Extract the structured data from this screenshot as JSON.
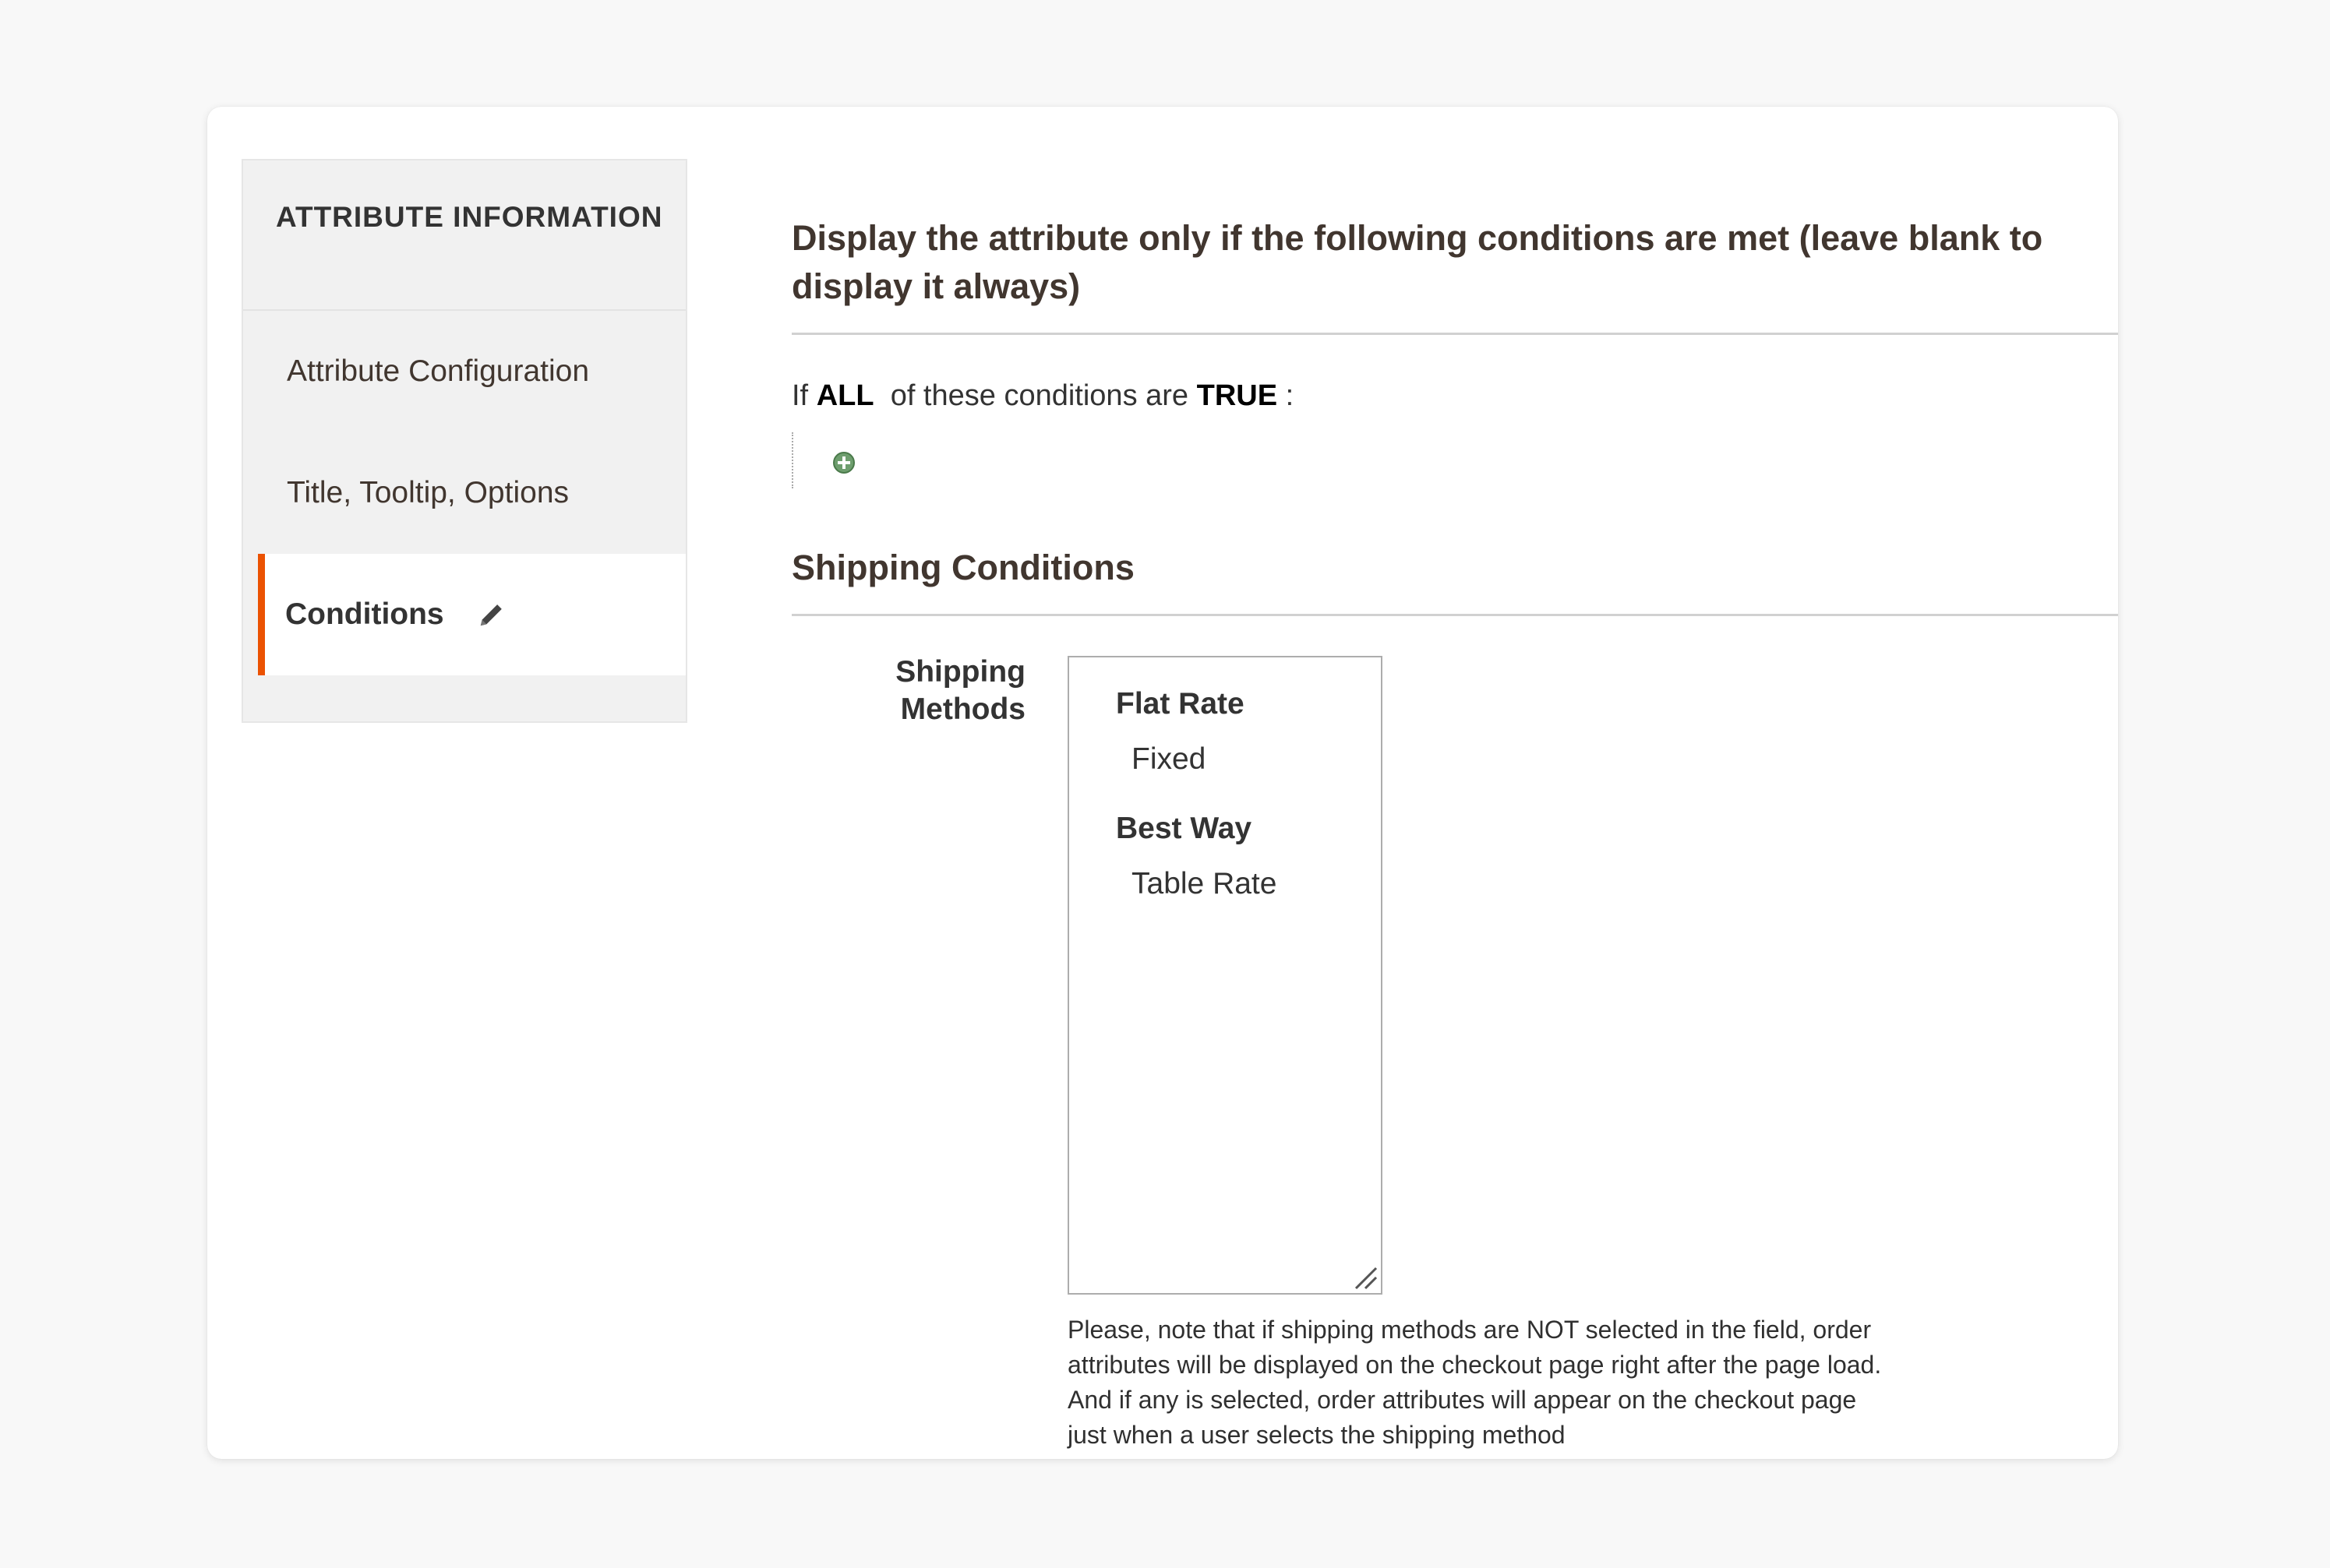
{
  "sidebar": {
    "title": "ATTRIBUTE INFORMATION",
    "items": [
      {
        "label": "Attribute Configuration"
      },
      {
        "label": "Title, Tooltip, Options"
      },
      {
        "label": "Conditions",
        "active": true
      }
    ]
  },
  "main": {
    "section_title": "Display the attribute only if the following conditions are met (leave blank to display it always)",
    "condition": {
      "prefix": "If",
      "aggregator": "ALL",
      "middle": "of these conditions are",
      "value": "TRUE",
      "suffix": ":"
    },
    "shipping_title": "Shipping Conditions",
    "shipping_field": {
      "label": "Shipping Methods",
      "groups": [
        {
          "label": "Flat Rate",
          "options": [
            "Fixed"
          ]
        },
        {
          "label": "Best Way",
          "options": [
            "Table Rate"
          ]
        }
      ],
      "note": "Please, note that if shipping methods are NOT selected in the field, order attributes will be displayed on the checkout page right after the page load. And if any is selected, order attributes will appear on the checkout page just when a user selects the shipping method"
    }
  },
  "colors": {
    "accent": "#eb5202",
    "add_icon": "#5a8a5a"
  },
  "icons": {
    "edit": "pencil-icon",
    "add_condition": "plus-circle-icon",
    "resize": "resize-handle-icon"
  }
}
